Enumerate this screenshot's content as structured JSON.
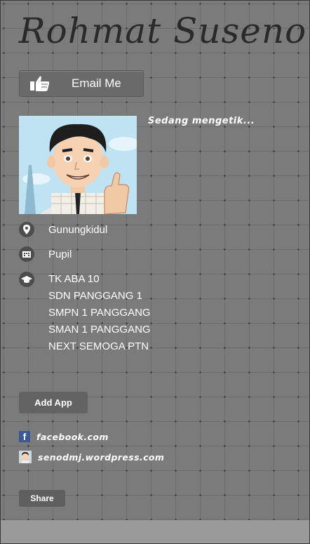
{
  "profile": {
    "name": "Rohmat Suseno",
    "email_button_label": "Email Me",
    "status": "Sedang mengetik..."
  },
  "info": {
    "location": "Gunungkidul",
    "occupation": "Pupil",
    "education": [
      "TK ABA 10",
      "SDN PANGGANG 1",
      "SMPN 1 PANGGANG",
      "SMAN 1 PANGGANG",
      "NEXT SEMOGA PTN"
    ]
  },
  "actions": {
    "add_app_label": "Add App",
    "share_label": "Share"
  },
  "links": [
    {
      "label": "facebook.com",
      "icon": "facebook-icon"
    },
    {
      "label": "senodmj.wordpress.com",
      "icon": "wordpress-avatar-icon"
    }
  ],
  "colors": {
    "background": "#7b7b7b",
    "button": "#6a6a6a",
    "icon_circle": "#4d4d4d",
    "text": "#ffffff",
    "facebook": "#3b5998"
  }
}
